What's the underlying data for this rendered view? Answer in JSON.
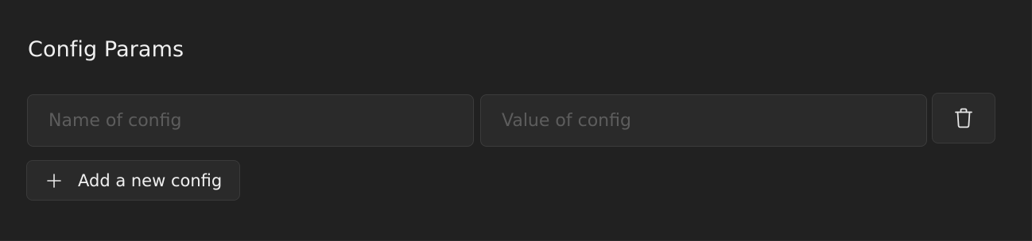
{
  "section": {
    "title": "Config Params"
  },
  "config_row": {
    "name_placeholder": "Name of config",
    "name_value": "",
    "value_placeholder": "Value of config",
    "value_value": "",
    "delete_icon": "trash-icon"
  },
  "add_button": {
    "label": "Add a new config",
    "icon": "plus-icon"
  },
  "colors": {
    "background": "#212121",
    "field_background": "#2a2a2a",
    "border": "#3c3c3c",
    "text": "#f0f0f0",
    "placeholder": "#5d5d5d"
  }
}
